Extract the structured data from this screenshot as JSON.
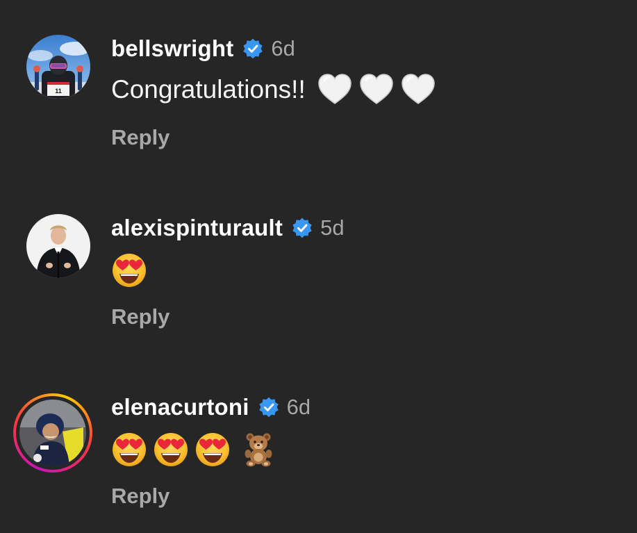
{
  "comments": [
    {
      "username": "bellswright",
      "verified": true,
      "time": "6d",
      "text": "Congratulations!!",
      "emojis": [
        "white-heart",
        "white-heart",
        "white-heart"
      ],
      "reply_label": "Reply"
    },
    {
      "username": "alexispinturault",
      "verified": true,
      "time": "5d",
      "text": "",
      "emojis": [
        "heart-eyes-face"
      ],
      "reply_label": "Reply"
    },
    {
      "username": "elenacurtoni",
      "verified": true,
      "time": "6d",
      "text": "",
      "emojis": [
        "heart-eyes-face",
        "heart-eyes-face",
        "heart-eyes-face",
        "teddy-bear"
      ],
      "reply_label": "Reply",
      "has_story_ring": true
    }
  ],
  "colors": {
    "background": "#262626",
    "username": "#ffffff",
    "secondary": "#a8a8a8",
    "verified_badge": "#3897f0"
  }
}
